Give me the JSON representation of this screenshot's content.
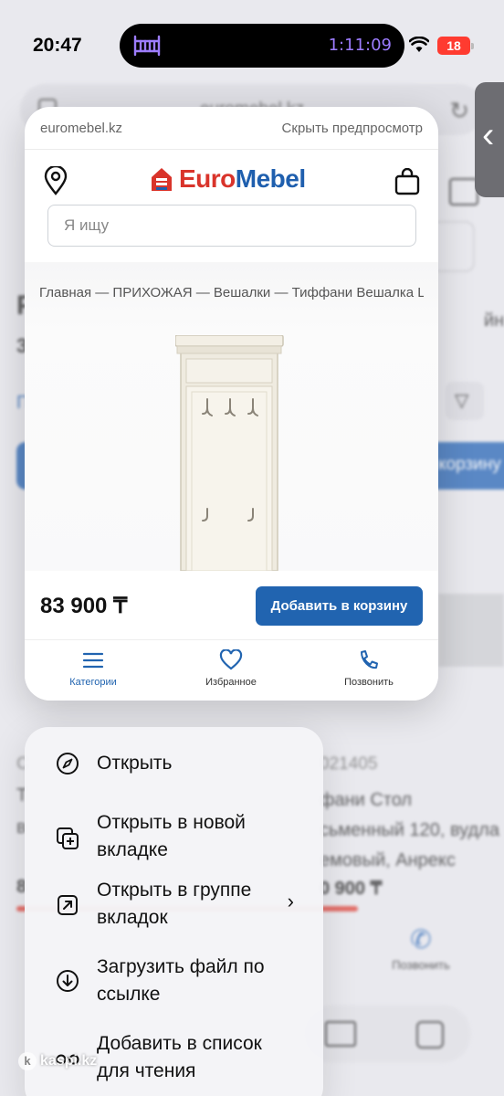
{
  "status_bar": {
    "time": "20:47",
    "timer": "1:11:09",
    "battery": "18"
  },
  "background_page": {
    "url": "euromebel.kz",
    "title_fragment": "Р",
    "subtitle_fragment": "3",
    "right_fragment": "йн",
    "link_fragment": "П",
    "cta_fragment": "корзину",
    "code_left": "С",
    "code_right": "021405",
    "name_left_line1": "Т",
    "name_left_line2": "в",
    "name_right": "фани Стол письменный 120, вудла кремовый, Анрекс",
    "name_right_lines": [
      "фани Стол",
      "сьменный 120, вудла",
      "емовый, Анрекс"
    ],
    "price_left": "8",
    "price_right": "0 900 ₸",
    "call_label": "Позвонить"
  },
  "preview": {
    "domain": "euromebel.kz",
    "hide_label": "Скрыть предпросмотр",
    "logo": {
      "euro": "Euro",
      "mebel": "Mebel"
    },
    "search_placeholder": "Я ищу",
    "breadcrumb": "Главная — ПРИХОЖАЯ — Вешалки — Тиффани Вешалка L, ",
    "price": "83 900 ₸",
    "add_to_cart": "Добавить в корзину",
    "nav": [
      {
        "label": "Категории",
        "icon": "menu-icon"
      },
      {
        "label": "Избранное",
        "icon": "heart-icon"
      },
      {
        "label": "Позвонить",
        "icon": "phone-icon"
      }
    ],
    "colors": {
      "brand_blue": "#2164b0",
      "brand_red": "#d9342b"
    }
  },
  "context_menu": {
    "items": [
      {
        "label": "Открыть",
        "icon": "compass-icon"
      },
      {
        "label": "Открыть в новой вкладке",
        "icon": "new-tab-icon"
      },
      {
        "label": "Открыть в группе вкладок",
        "icon": "tab-group-icon",
        "submenu": true
      },
      {
        "label": "Загрузить файл по ссылке",
        "icon": "download-icon"
      },
      {
        "label": "Добавить в список для чтения",
        "icon": "reading-list-icon"
      }
    ]
  },
  "watermark": "kaspi.kz"
}
